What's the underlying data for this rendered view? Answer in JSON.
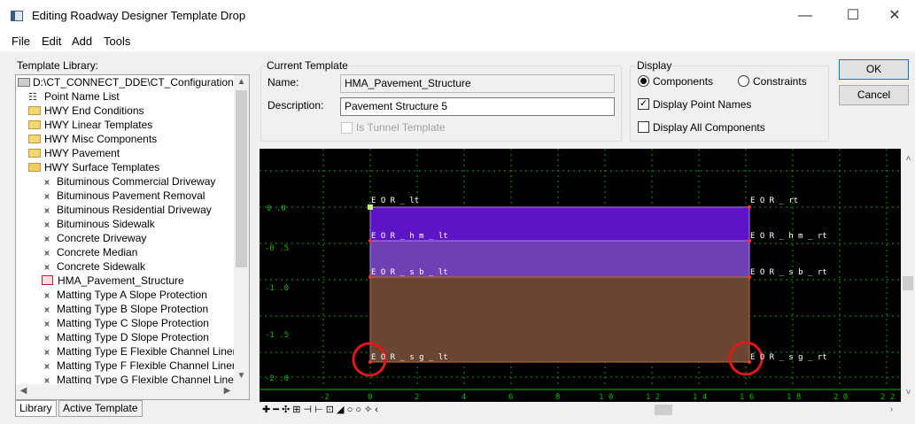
{
  "window": {
    "title": "Editing Roadway Designer Template Drop",
    "minimize": "—",
    "maximize": "☐",
    "close": "✕"
  },
  "menu": [
    "File",
    "Edit",
    "Add",
    "Tools"
  ],
  "library": {
    "label": "Template Library:",
    "root": "D:\\CT_CONNECT_DDE\\CT_Configuration\\O",
    "items": [
      {
        "label": "Point Name List",
        "kind": "list"
      },
      {
        "label": "HWY End Conditions",
        "kind": "folder"
      },
      {
        "label": "HWY Linear Templates",
        "kind": "folder"
      },
      {
        "label": "HWY Misc Components",
        "kind": "folder"
      },
      {
        "label": "HWY Pavement",
        "kind": "folder"
      },
      {
        "label": "HWY Surface Templates",
        "kind": "folder-open"
      },
      {
        "label": "Bituminous Commercial Driveway",
        "kind": "template"
      },
      {
        "label": "Bituminous Pavement Removal",
        "kind": "template"
      },
      {
        "label": "Bituminous Residential Driveway",
        "kind": "template"
      },
      {
        "label": "Bituminous Sidewalk",
        "kind": "template"
      },
      {
        "label": "Concrete Driveway",
        "kind": "template"
      },
      {
        "label": "Concrete Median",
        "kind": "template"
      },
      {
        "label": "Concrete Sidewalk",
        "kind": "template"
      },
      {
        "label": "HMA_Pavement_Structure",
        "kind": "selected"
      },
      {
        "label": "Matting Type A Slope Protection",
        "kind": "template"
      },
      {
        "label": "Matting Type B Slope Protection",
        "kind": "template"
      },
      {
        "label": "Matting Type C Slope Protection",
        "kind": "template"
      },
      {
        "label": "Matting Type D Slope Protection",
        "kind": "template"
      },
      {
        "label": "Matting Type E Flexible Channel Liner",
        "kind": "template"
      },
      {
        "label": "Matting Type F Flexible Channel Liner",
        "kind": "template"
      },
      {
        "label": "Matting Type G Flexible Channel Liner",
        "kind": "template"
      }
    ],
    "tabs": [
      "Library",
      "Active Template"
    ]
  },
  "current_template": {
    "group_label": "Current Template",
    "name_label": "Name:",
    "name_value": "HMA_Pavement_Structure",
    "description_label": "Description:",
    "description_value": "Pavement Structure 5",
    "tunnel_label": "Is Tunnel Template"
  },
  "display": {
    "group_label": "Display",
    "components_label": "Components",
    "constraints_label": "Constraints",
    "point_names_label": "Display Point Names",
    "all_components_label": "Display All Components"
  },
  "buttons": {
    "ok": "OK",
    "cancel": "Cancel"
  },
  "canvas": {
    "y_ticks": [
      "0 .0",
      "-0 .5",
      "-1 .0",
      "-1 .5",
      "-2 .0"
    ],
    "x_ticks": [
      "-2",
      "0",
      "2",
      "4",
      "6",
      "8",
      "1 0",
      "1 2",
      "1 4",
      "1 6",
      "1 8",
      "2 0",
      "2 2"
    ],
    "points": {
      "eor_lt": "E O R _ lt",
      "eor_rt": "E O R _ rt",
      "eor_hm_lt": "E O R _ h m _ lt",
      "eor_hm_rt": "E O R _ h m _ rt",
      "eor_sb_lt": "E O R _ s b _ lt",
      "eor_sb_rt": "E O R _ s b _ rt",
      "eor_sg_lt": "E O R _ s g _ lt",
      "eor_sg_rt": "E O R _ s g _ rt"
    },
    "colors": {
      "background": "#000000",
      "grid": "#00c000",
      "hma_layer": "#5d14c4",
      "subbase_layer": "#6f3fb4",
      "subgrade_layer": "#6a4531",
      "highlight_circle": "#e01818"
    },
    "toolbar_glyphs": "✚ ━ ✣ ⊞ ⊣ ⊢ ⊡ ◢ ○ ○ ✧ ‹"
  }
}
